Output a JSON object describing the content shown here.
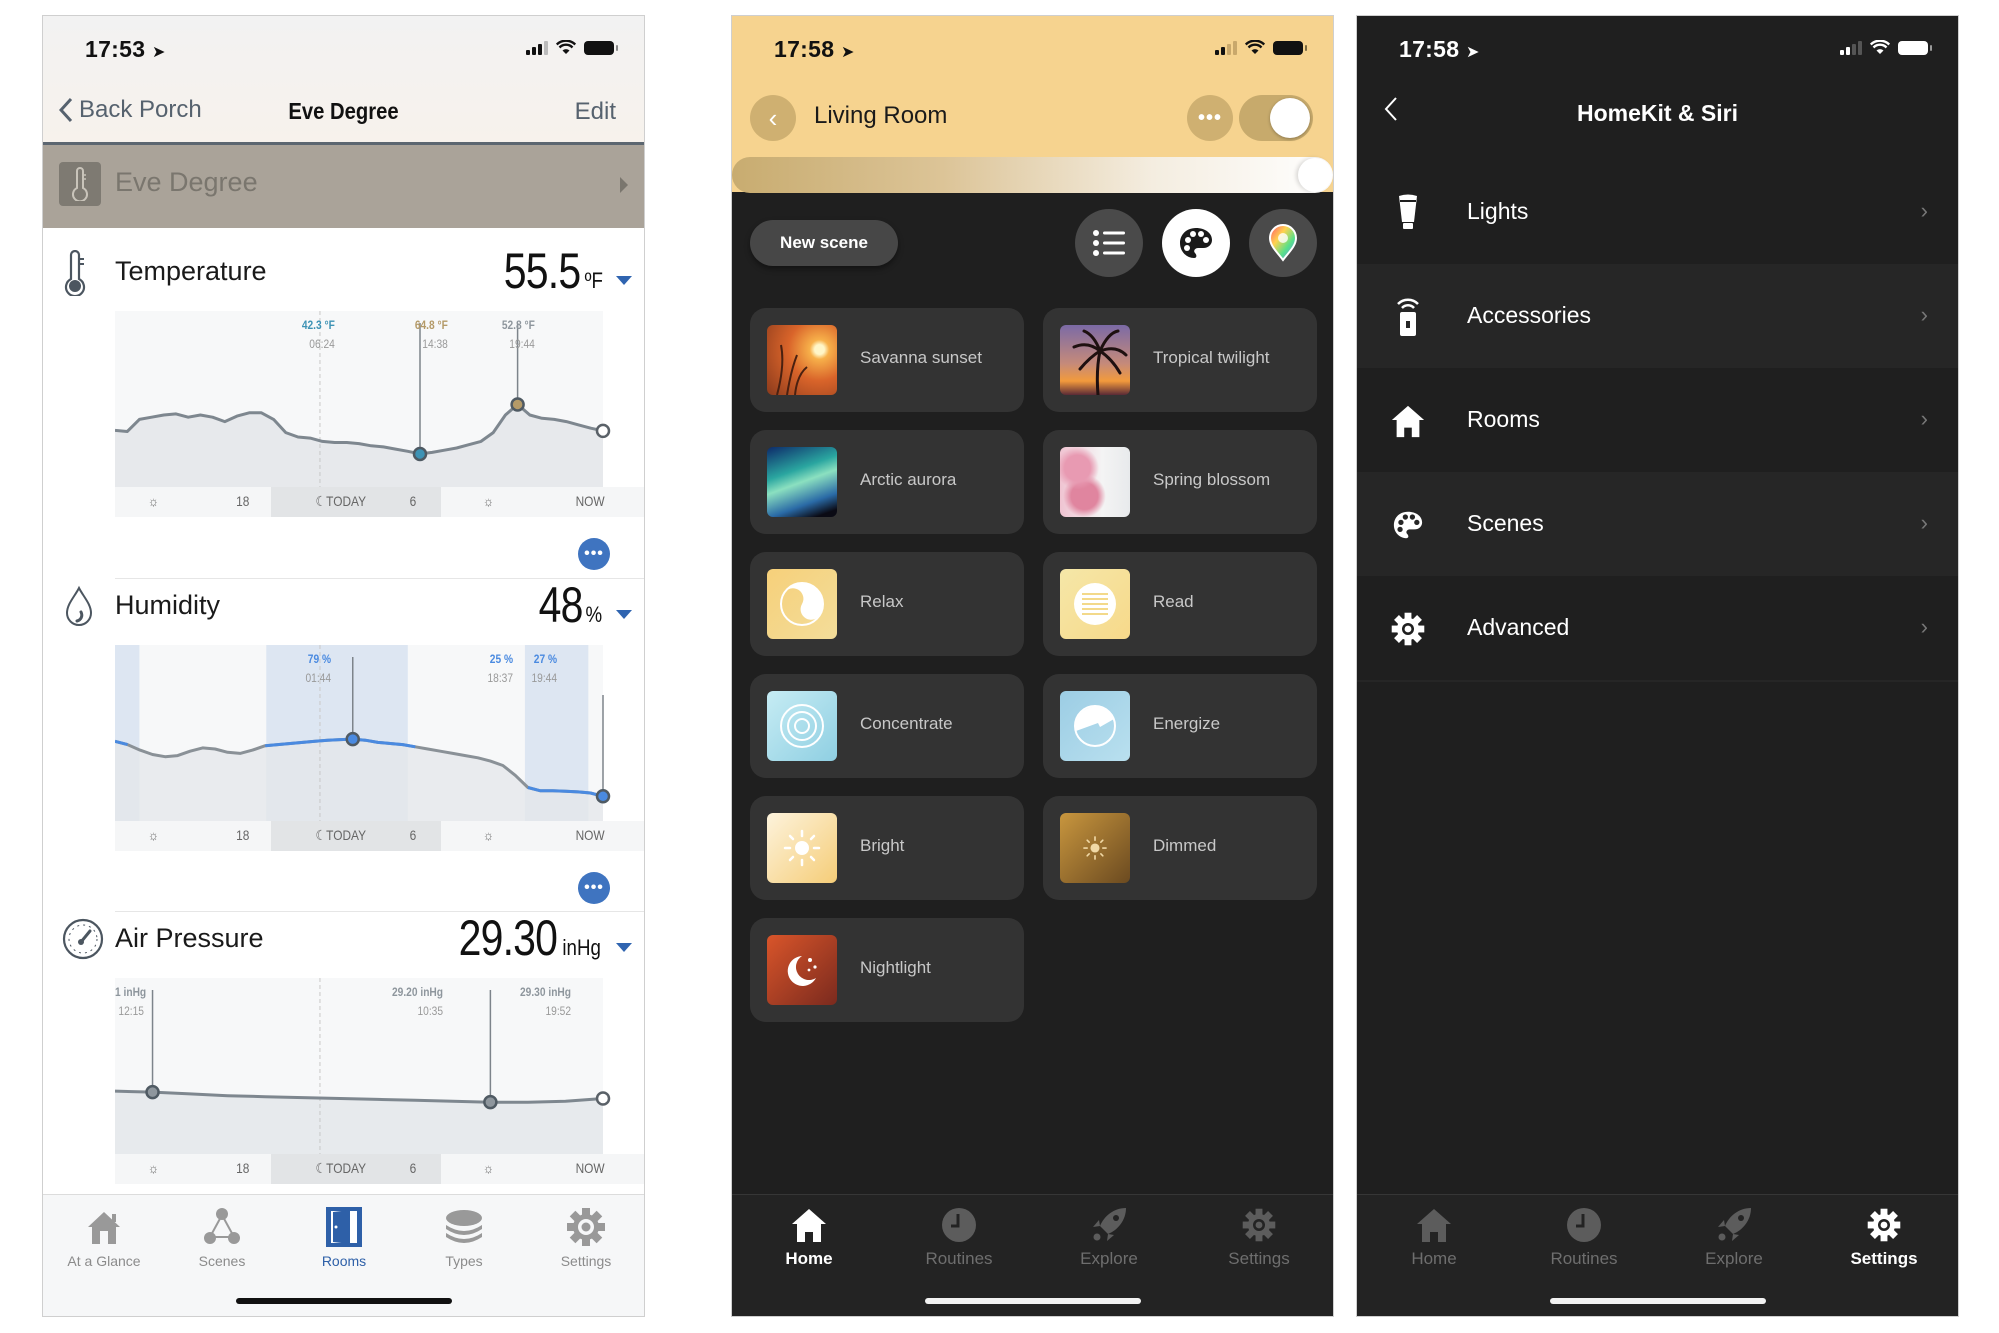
{
  "eve": {
    "status": {
      "time": "17:53"
    },
    "nav": {
      "back_label": "Back Porch",
      "title": "Eve Degree",
      "edit_label": "Edit"
    },
    "device": {
      "name": "Eve Degree"
    },
    "temperature": {
      "label": "Temperature",
      "value": "55.5",
      "unit": "ºF",
      "min": {
        "value": "42.3 °F",
        "time": "06:24"
      },
      "max": {
        "value": "64.8 °F",
        "time": "14:38"
      },
      "current": {
        "value": "52.8 °F",
        "time": "19:44"
      }
    },
    "humidity": {
      "label": "Humidity",
      "value": "48",
      "unit": "%",
      "max": {
        "value": "79 %",
        "time": "01:44"
      },
      "min": {
        "value": "25 %",
        "time": "18:37"
      },
      "current": {
        "value": "27 %",
        "time": "19:44"
      }
    },
    "pressure": {
      "label": "Air Pressure",
      "value": "29.30",
      "unit": "inHg",
      "max": {
        "value": "1 inHg",
        "time": "12:15"
      },
      "min": {
        "value": "29.20 inHg",
        "time": "10:35"
      },
      "current": {
        "value": "29.30 inHg",
        "time": "19:52"
      }
    },
    "axis": {
      "t1": "18",
      "today": "TODAY",
      "t2": "6",
      "now": "NOW"
    },
    "more_label": "•••",
    "tabs": [
      {
        "label": "At a Glance",
        "icon": "house-icon"
      },
      {
        "label": "Scenes",
        "icon": "scenes-icon"
      },
      {
        "label": "Rooms",
        "icon": "door-icon",
        "active": true
      },
      {
        "label": "Types",
        "icon": "layers-icon"
      },
      {
        "label": "Settings",
        "icon": "gear-icon"
      }
    ],
    "colors": {
      "accent": "#2e60a8",
      "min_temp": "#3e93b5",
      "max_temp": "#b49a68",
      "humidity_line": "#4a8ae0"
    }
  },
  "chart_data": [
    {
      "type": "area",
      "title": "Temperature",
      "unit": "°F",
      "x_labels": [
        "sun",
        "18",
        "TODAY",
        "6",
        "sun",
        "NOW"
      ],
      "markers": [
        {
          "label": "min",
          "value": 42.3,
          "time": "06:24"
        },
        {
          "label": "max",
          "value": 64.8,
          "time": "14:38"
        },
        {
          "label": "current",
          "value": 52.8,
          "time": "19:44"
        }
      ],
      "series": [
        {
          "name": "Temperature",
          "values": [
            53,
            52.5,
            58,
            59,
            60,
            60.5,
            59,
            60,
            59,
            57,
            59.5,
            61,
            61,
            58,
            52,
            50,
            49.5,
            48,
            47.5,
            47.5,
            47,
            46,
            45.5,
            44.5,
            43.5,
            42.3,
            43,
            44,
            45,
            46.5,
            48,
            52,
            60,
            64.8,
            60,
            58.5,
            58,
            57,
            55.5,
            54,
            52.8
          ]
        }
      ]
    },
    {
      "type": "area",
      "title": "Humidity",
      "unit": "%",
      "x_labels": [
        "sun",
        "18",
        "TODAY",
        "6",
        "sun",
        "NOW"
      ],
      "markers": [
        {
          "label": "max",
          "value": 79,
          "time": "01:44"
        },
        {
          "label": "min",
          "value": 25,
          "time": "18:37"
        },
        {
          "label": "current",
          "value": 27,
          "time": "19:44"
        }
      ],
      "series": [
        {
          "name": "Humidity",
          "values": [
            77,
            74,
            69,
            65,
            63,
            64,
            68,
            71,
            70,
            67,
            66,
            69,
            73,
            74,
            75,
            76,
            77,
            78,
            78.5,
            79,
            78,
            76,
            75,
            74,
            72,
            70,
            68,
            66,
            64,
            62,
            59,
            55,
            46,
            35,
            32,
            32,
            31.5,
            31,
            30,
            27
          ]
        }
      ]
    },
    {
      "type": "area",
      "title": "Air Pressure",
      "unit": "inHg",
      "x_labels": [
        "sun",
        "18",
        "TODAY",
        "6",
        "sun",
        "NOW"
      ],
      "markers": [
        {
          "label": "max",
          "value": 29.31,
          "time": "12:15"
        },
        {
          "label": "min",
          "value": 29.2,
          "time": "10:35"
        },
        {
          "label": "current",
          "value": 29.3,
          "time": "19:52"
        }
      ],
      "series": [
        {
          "name": "Air Pressure",
          "values": [
            29.32,
            29.31,
            29.29,
            29.27,
            29.26,
            29.25,
            29.24,
            29.23,
            29.22,
            29.21,
            29.2,
            29.2,
            29.21,
            29.24
          ]
        }
      ]
    }
  ],
  "hue": {
    "status": {
      "time": "17:58"
    },
    "header": {
      "room": "Living Room",
      "more_label": "•••",
      "power_on": true,
      "brightness": 1.0
    },
    "new_scene_label": "New scene",
    "view_modes": [
      {
        "name": "list",
        "icon": "list-icon"
      },
      {
        "name": "scenes",
        "icon": "palette-icon",
        "active": true
      },
      {
        "name": "color",
        "icon": "color-pin-icon"
      }
    ],
    "scenes": [
      {
        "name": "Savanna sunset",
        "thumb": "sunset-photo"
      },
      {
        "name": "Tropical twilight",
        "thumb": "palm-photo"
      },
      {
        "name": "Arctic aurora",
        "thumb": "aurora-photo"
      },
      {
        "name": "Spring blossom",
        "thumb": "blossom-photo"
      },
      {
        "name": "Relax",
        "thumb": "relax-icon"
      },
      {
        "name": "Read",
        "thumb": "read-icon"
      },
      {
        "name": "Concentrate",
        "thumb": "concentrate-icon"
      },
      {
        "name": "Energize",
        "thumb": "energize-icon"
      },
      {
        "name": "Bright",
        "thumb": "bright-icon"
      },
      {
        "name": "Dimmed",
        "thumb": "dimmed-icon"
      },
      {
        "name": "Nightlight",
        "thumb": "nightlight-icon"
      }
    ],
    "tabs": [
      {
        "label": "Home",
        "active": true
      },
      {
        "label": "Routines"
      },
      {
        "label": "Explore"
      },
      {
        "label": "Settings"
      }
    ],
    "colors": {
      "header": "#f6d38f",
      "bg": "#1f1f1f",
      "card": "#333333"
    }
  },
  "homekit": {
    "status": {
      "time": "17:58"
    },
    "title": "HomeKit & Siri",
    "items": [
      {
        "label": "Lights",
        "icon": "bulb-icon"
      },
      {
        "label": "Accessories",
        "icon": "remote-icon"
      },
      {
        "label": "Rooms",
        "icon": "house-icon"
      },
      {
        "label": "Scenes",
        "icon": "palette-icon"
      },
      {
        "label": "Advanced",
        "icon": "gear-icon"
      }
    ],
    "tabs": [
      {
        "label": "Home"
      },
      {
        "label": "Routines"
      },
      {
        "label": "Explore"
      },
      {
        "label": "Settings",
        "active": true
      }
    ]
  }
}
